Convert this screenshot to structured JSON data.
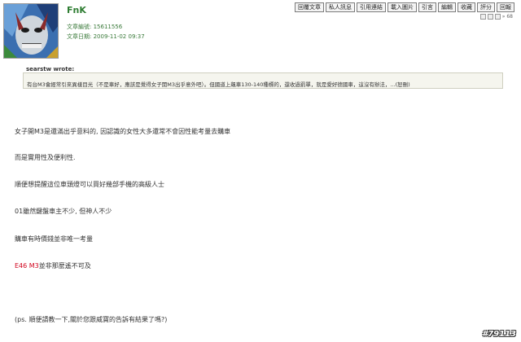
{
  "post": {
    "author": "FnK",
    "article_id_label": "文章編號: 15611556",
    "article_date_label": "文章日期: 2009-11-02 09:37",
    "page_indicator": "68"
  },
  "toolbar": {
    "buttons": [
      "回覆文章",
      "私人訊息",
      "引用連結",
      "載入圖片",
      "引言",
      "編輯",
      "收藏",
      "評分",
      "回報"
    ]
  },
  "quote": {
    "header": "searstw wrote:",
    "text": "有台M3會經常引來異樣目光（不是車好，應該是覺得女子開M3出乎意外吧）。但國道上飆車130-140種標的，還收過罰單，就是愛好德國車，這沒有辦法，...(恕刪)"
  },
  "body": {
    "p1": "女子開M3是還滿出乎意料的, 因認識的女性大多還常不會因性能考量去購車",
    "p2": "而是實用性及便利性.",
    "p3": "順便想提醒這位車頭燈可以買好幾部手機的高級人士",
    "p4": "01雖然鍵盤車主不少, 但神人不少",
    "p5": "購車有時價錢並非唯一考量",
    "p6_red": "E46 M3",
    "p6_rest": "並非那麼遙不可及",
    "p7": "(ps. 順便請教一下,關於您跟威寶的告訴有結果了嗎?)"
  },
  "watermark": "#79113"
}
